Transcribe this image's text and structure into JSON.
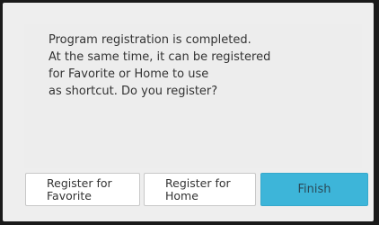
{
  "dialog": {
    "message_lines": [
      "Program registration is completed.",
      "At the same time, it can be registered",
      "for Favorite or Home to use",
      "as shortcut. Do you register?"
    ]
  },
  "buttons": {
    "register_favorite": [
      "Register for",
      "Favorite"
    ],
    "register_home": [
      "Register for",
      "Home"
    ],
    "finish": "Finish"
  },
  "colors": {
    "accent": "#3db5d9",
    "dialog_bg": "#eeeeee",
    "frame": "#1a1a1a"
  }
}
